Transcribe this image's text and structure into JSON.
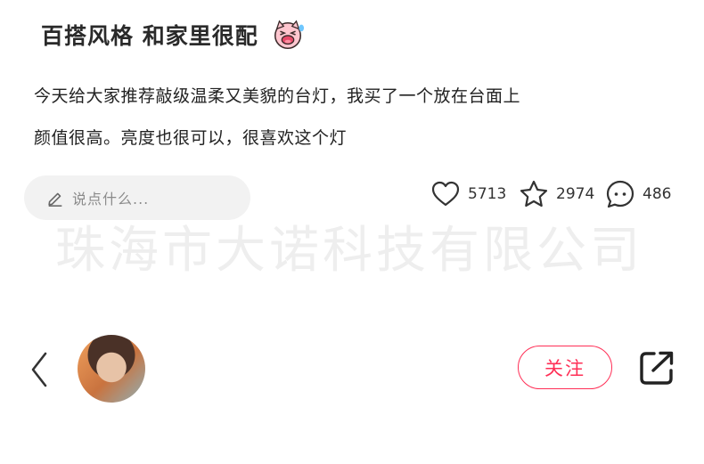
{
  "post": {
    "title": "百搭风格 和家里很配",
    "title_emoji": "laughing-pig-emoji",
    "body_line1": "今天给大家推荐敲级温柔又美貌的台灯，我买了一个放在台面上",
    "body_line2": "颜值很高。亮度也很可以，很喜欢这个灯"
  },
  "comment": {
    "placeholder": "说点什么..."
  },
  "stats": {
    "likes": "5713",
    "favorites": "2974",
    "comments": "486"
  },
  "watermark": "珠海市大诺科技有限公司",
  "footer": {
    "follow_label": "关注"
  },
  "colors": {
    "accent": "#ff2f56",
    "watermark": "#eeeeee",
    "comment_bg": "#f2f2f2"
  },
  "icons": [
    "pen-icon",
    "heart-icon",
    "star-icon",
    "comment-icon",
    "back-chevron-icon",
    "share-icon"
  ]
}
